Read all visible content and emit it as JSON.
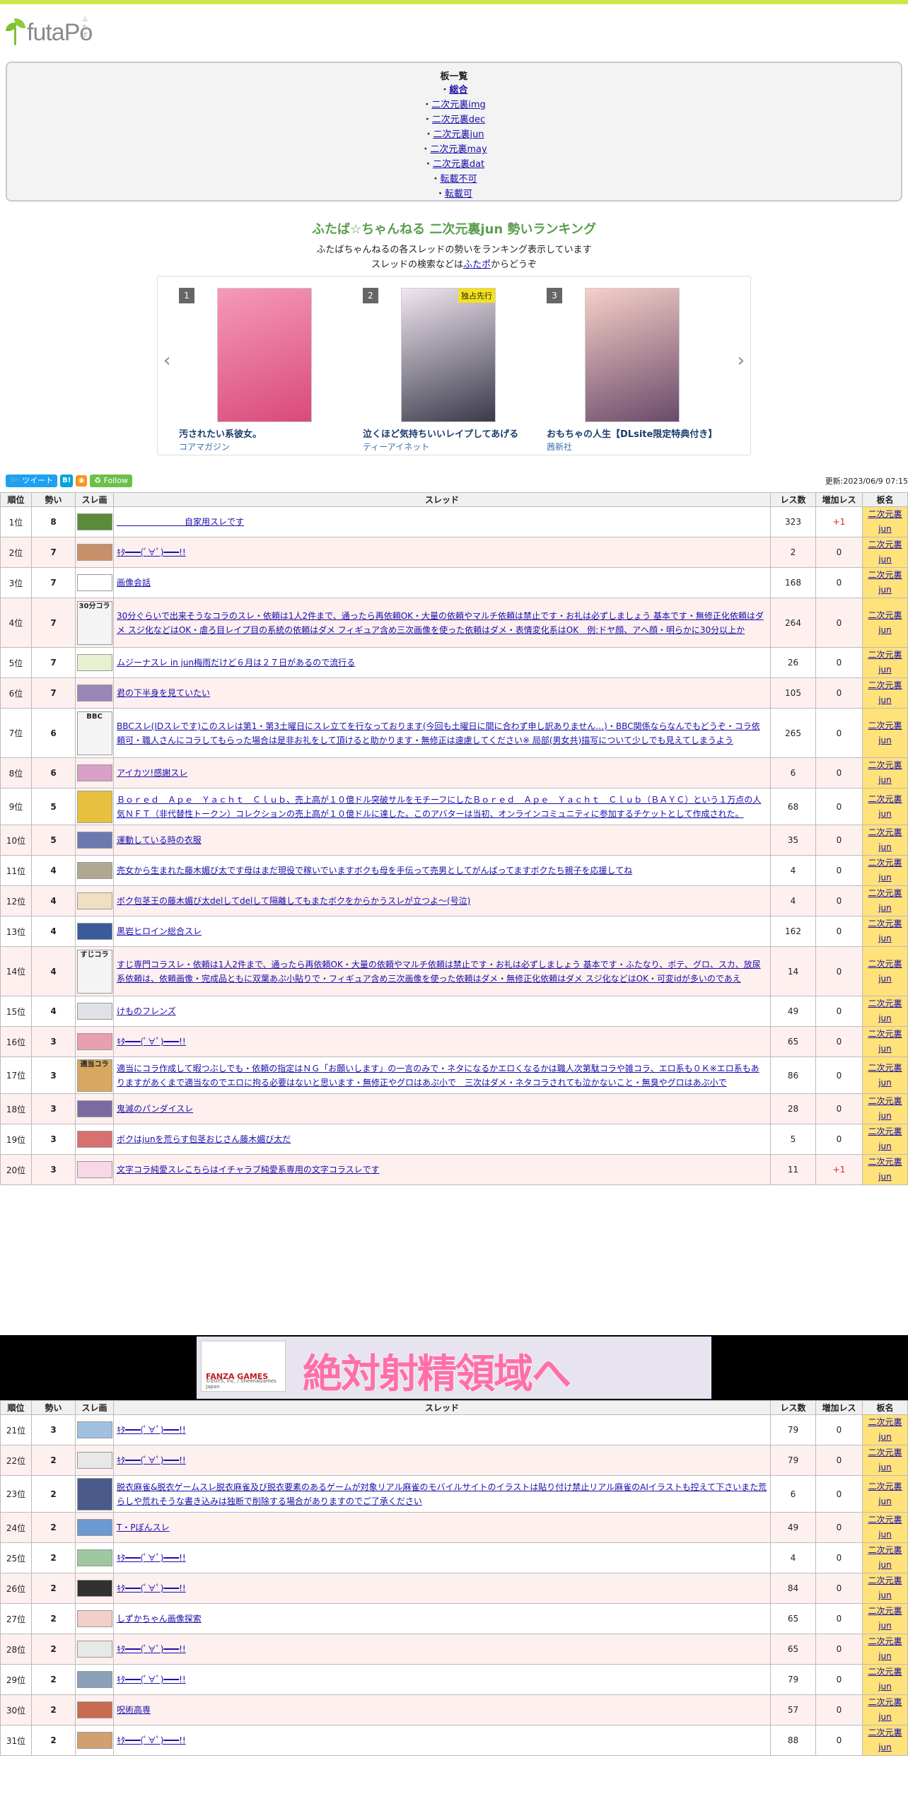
{
  "logo": {
    "text": "futaPo",
    "ruby": "ふたポ"
  },
  "board_menu": {
    "title": "板一覧",
    "items": [
      {
        "label": "総合",
        "bold": true
      },
      {
        "label": "二次元裏img"
      },
      {
        "label": "二次元裏dec"
      },
      {
        "label": "二次元裏jun"
      },
      {
        "label": "二次元裏may"
      },
      {
        "label": "二次元裏dat"
      },
      {
        "label": "転載不可"
      },
      {
        "label": "転載可"
      }
    ]
  },
  "header": {
    "title": "ふたば☆ちゃんねる 二次元裏jun 勢いランキング",
    "subtitle": "ふたばちゃんねるの各スレッドの勢いをランキング表示しています",
    "search_prefix": "スレッドの検索などは",
    "search_link": "ふたポ",
    "search_suffix": "からどうぞ"
  },
  "carousel": {
    "prev": "‹",
    "next": "›",
    "items": [
      {
        "rank": "1",
        "title": "汚されたい系彼女。",
        "publisher": "コアマガジン",
        "badge": ""
      },
      {
        "rank": "2",
        "title": "泣くほど気持ちいいレイプしてあげる",
        "publisher": "ティーアイネット",
        "badge": "独占先行"
      },
      {
        "rank": "3",
        "title": "おもちゃの人生【DLsite限定特典付き】",
        "publisher": "茜新社",
        "badge": ""
      }
    ]
  },
  "share": {
    "tweet": "ツイート",
    "hatena": "B!",
    "rss": "RSS",
    "follow": "Follow"
  },
  "updated": "更新:2023/06/9 07:15",
  "table_headers": [
    "順位",
    "勢い",
    "スレ画",
    "スレッド",
    "レス数",
    "増加レス",
    "板名"
  ],
  "rows_a": [
    {
      "rank": "1位",
      "speed": "8",
      "title": "　　　　　　　　自家用スレです",
      "res": "323",
      "inc": "+1",
      "board": "二次元裏jun",
      "thumb": "#5a8a3a"
    },
    {
      "rank": "2位",
      "speed": "7",
      "title": "ｷﾀ━━━(ﾟ∀ﾟ)━━━!!",
      "res": "2",
      "inc": "0",
      "board": "二次元裏jun",
      "thumb": "#c8906a"
    },
    {
      "rank": "3位",
      "speed": "7",
      "title": "画像会話",
      "res": "168",
      "inc": "0",
      "board": "二次元裏jun",
      "thumb": "#ffffff"
    },
    {
      "rank": "4位",
      "speed": "7",
      "title": "30分ぐらいで出来そうなコラのスレ・依頼は1人2件まで、通ったら再依頼OK・大量の依頼やマルチ依頼は禁止です・お礼は必ずしましょう 基本です・無修正化依頼はダメ スジ化などはOK・虐ろ目レイプ目の系統の依頼はダメ フィギュア含め三次画像を使った依頼はダメ・表情変化系はOK　例:ドヤ顔、アヘ顔・明らかに30分以上か",
      "res": "264",
      "inc": "0",
      "board": "二次元裏jun",
      "thumb": "#f4f4f4",
      "thumb_text": "30分コラ"
    },
    {
      "rank": "5位",
      "speed": "7",
      "title": "ムジーナスレ in jun梅雨だけど６月は２７日があるので流行る",
      "res": "26",
      "inc": "0",
      "board": "二次元裏jun",
      "thumb": "#e8f0d0"
    },
    {
      "rank": "6位",
      "speed": "7",
      "title": "君の下半身を見ていたい",
      "res": "105",
      "inc": "0",
      "board": "二次元裏jun",
      "thumb": "#9a86b8"
    },
    {
      "rank": "7位",
      "speed": "6",
      "title": "BBCスレ(IDスレです)このスレは第1・第3土曜日にスレ立てを行なっております(今回も土曜日に間に合わず申し訳ありません…)・BBC関係ならなんでもどうぞ・コラ依頼可・職人さんにコラしてもらった場合は是非お礼をして頂けると助かります・無修正は遠慮してください※ 局部(男女共)描写について少しでも見えてしまうよう",
      "res": "265",
      "inc": "0",
      "board": "二次元裏jun",
      "thumb": "#f4f4f4",
      "thumb_text": "BBC"
    },
    {
      "rank": "8位",
      "speed": "6",
      "title": "アイカツ!感謝スレ",
      "res": "6",
      "inc": "0",
      "board": "二次元裏jun",
      "thumb": "#d8a0c8"
    },
    {
      "rank": "9位",
      "speed": "5",
      "title": "Ｂｏｒｅｄ　Ａｐｅ　Ｙａｃｈｔ　Ｃｌｕｂ、売上高が１０億ドル突破サルをモチーフにしたＢｏｒｅｄ　Ａｐｅ　Ｙａｃｈｔ　Ｃｌｕｂ（ＢＡＹＣ）という１万点の人気ＮＦＴ（非代替性トークン）コレクションの売上高が１０億ドルに達した。このアバターは当初、オンラインコミュニティに参加するチケットとして作成された。",
      "res": "68",
      "inc": "0",
      "board": "二次元裏jun",
      "thumb": "#e8c040"
    },
    {
      "rank": "10位",
      "speed": "5",
      "title": "運動している時の衣服",
      "res": "35",
      "inc": "0",
      "board": "二次元裏jun",
      "thumb": "#6a7ab0"
    },
    {
      "rank": "11位",
      "speed": "4",
      "title": "売女から生まれた藤木媚び太です母はまだ現役で稼いでいますボクも母を手伝って売男としてがんばってますボクたち親子を応援してね",
      "res": "4",
      "inc": "0",
      "board": "二次元裏jun",
      "thumb": "#b0a890"
    },
    {
      "rank": "12位",
      "speed": "4",
      "title": "ボク包茎王の藤木媚び太delしてdelして隔離してもまたボクをからかうスレが立つよ〜(号泣)",
      "res": "4",
      "inc": "0",
      "board": "二次元裏jun",
      "thumb": "#f0e0c0"
    },
    {
      "rank": "13位",
      "speed": "4",
      "title": "黒岩ヒロイン総合スレ",
      "res": "162",
      "inc": "0",
      "board": "二次元裏jun",
      "thumb": "#3a5a9a"
    },
    {
      "rank": "14位",
      "speed": "4",
      "title": "すじ専門コラスレ・依頼は1人2件まで、通ったら再依頼OK・大量の依頼やマルチ依頼は禁止です・お礼は必ずしましょう 基本です・ふたなり、ボテ、グロ、スカ、放尿系依頼は、依頼画像・完成品ともに双葉あぷ小貼りで・フィギュア含め三次画像を使った依頼はダメ・無修正化依頼はダメ スジ化などはOK・可変idが多いのであえ",
      "res": "14",
      "inc": "0",
      "board": "二次元裏jun",
      "thumb": "#f4f4f4",
      "thumb_text": "すじコラ"
    },
    {
      "rank": "15位",
      "speed": "4",
      "title": "けものフレンズ",
      "res": "49",
      "inc": "0",
      "board": "二次元裏jun",
      "thumb": "#e0e0e8"
    },
    {
      "rank": "16位",
      "speed": "3",
      "title": "ｷﾀ━━━(ﾟ∀ﾟ)━━━!!",
      "res": "65",
      "inc": "0",
      "board": "二次元裏jun",
      "thumb": "#e8a0b0"
    },
    {
      "rank": "17位",
      "speed": "3",
      "title": "適当にコラ作成して暇つぶしでも・依頼の指定はＮＧ「お願いします」の一言のみで・ネタになるかエロくなるかは職人次第駄コラや雑コラ、エロ系も０Ｋ※エロ系もありますがあくまで適当なのでエロに拘る必要はないと思います・無修正やグロはあぷ小で　三次はダメ・ネタコラされても泣かないこと・無臭やグロはあぷ小で",
      "res": "86",
      "inc": "0",
      "board": "二次元裏jun",
      "thumb": "#d8a860",
      "thumb_text": "適当コラ"
    },
    {
      "rank": "18位",
      "speed": "3",
      "title": "鬼滅のパンダイスレ",
      "res": "28",
      "inc": "0",
      "board": "二次元裏jun",
      "thumb": "#7a6aa0"
    },
    {
      "rank": "19位",
      "speed": "3",
      "title": "ボクはjunを荒らす包茎おじさん藤木媚び太だ",
      "res": "5",
      "inc": "0",
      "board": "二次元裏jun",
      "thumb": "#d87070"
    },
    {
      "rank": "20位",
      "speed": "3",
      "title": "文字コラ純愛スレこちらはイチャラブ純愛系専用の文字コラスレです",
      "res": "11",
      "inc": "+1",
      "board": "二次元裏jun",
      "thumb": "#f8d8e8"
    }
  ],
  "ad": {
    "logo_brand": "FANZA GAMES",
    "copyright": "©EGYS, Inc. / SheenaGames Japan",
    "headline": "絶対射精領域へ"
  },
  "rows_b": [
    {
      "rank": "21位",
      "speed": "3",
      "title": "ｷﾀ━━━(ﾟ∀ﾟ)━━━!!",
      "res": "79",
      "inc": "0",
      "board": "二次元裏jun",
      "thumb": "#a0c0e0"
    },
    {
      "rank": "22位",
      "speed": "2",
      "title": "ｷﾀ━━━(ﾟ∀ﾟ)━━━!!",
      "res": "79",
      "inc": "0",
      "board": "二次元裏jun",
      "thumb": "#e8e8e8"
    },
    {
      "rank": "23位",
      "speed": "2",
      "title": "脱衣麻雀&脱衣ゲームスレ脱衣麻雀及び脱衣要素のあるゲームが対象リアル麻雀のモバイルサイトのイラストは貼り付け禁止リアル麻雀のAIイラストも控えて下さいまた荒らしや荒れそうな書き込みは独断で削除する場合がありますのでご了承ください",
      "res": "6",
      "inc": "0",
      "board": "二次元裏jun",
      "thumb": "#4a5a8a"
    },
    {
      "rank": "24位",
      "speed": "2",
      "title": "T・Pぼんスレ",
      "res": "49",
      "inc": "0",
      "board": "二次元裏jun",
      "thumb": "#6a9ad0"
    },
    {
      "rank": "25位",
      "speed": "2",
      "title": "ｷﾀ━━━(ﾟ∀ﾟ)━━━!!",
      "res": "4",
      "inc": "0",
      "board": "二次元裏jun",
      "thumb": "#a0c8a0"
    },
    {
      "rank": "26位",
      "speed": "2",
      "title": "ｷﾀ━━━(ﾟ∀ﾟ)━━━!!",
      "res": "84",
      "inc": "0",
      "board": "二次元裏jun",
      "thumb": "#303030"
    },
    {
      "rank": "27位",
      "speed": "2",
      "title": "しずかちゃん画像探索",
      "res": "65",
      "inc": "0",
      "board": "二次元裏jun",
      "thumb": "#f0d0c8"
    },
    {
      "rank": "28位",
      "speed": "2",
      "title": "ｷﾀ━━━(ﾟ∀ﾟ)━━━!!",
      "res": "65",
      "inc": "0",
      "board": "二次元裏jun",
      "thumb": "#e8e8e8"
    },
    {
      "rank": "29位",
      "speed": "2",
      "title": "ｷﾀ━━━(ﾟ∀ﾟ)━━━!!",
      "res": "79",
      "inc": "0",
      "board": "二次元裏jun",
      "thumb": "#8aa0b8"
    },
    {
      "rank": "30位",
      "speed": "2",
      "title": "呪術高専",
      "res": "57",
      "inc": "0",
      "board": "二次元裏jun",
      "thumb": "#c86a50"
    },
    {
      "rank": "31位",
      "speed": "2",
      "title": "ｷﾀ━━━(ﾟ∀ﾟ)━━━!!",
      "res": "88",
      "inc": "0",
      "board": "二次元裏jun",
      "thumb": "#d0a070"
    }
  ]
}
